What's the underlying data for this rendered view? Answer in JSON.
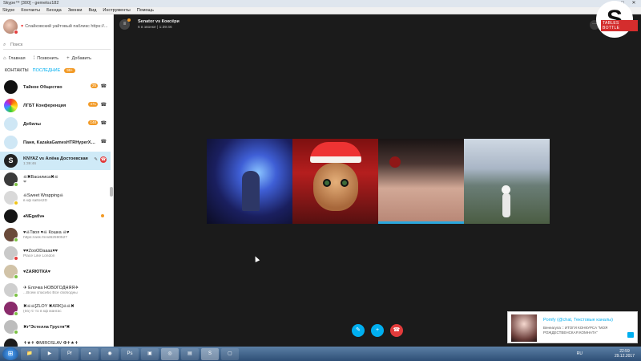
{
  "window": {
    "title": "Skype™ [300] - gemeloz182",
    "buttons": [
      "–",
      "□",
      "✕"
    ]
  },
  "menu": [
    "Skype",
    "Контакты",
    "Беседа",
    "Звонки",
    "Вид",
    "Инструменты",
    "Помощь"
  ],
  "profile": {
    "mood": "Спайковский уайтовый пабликс https://...",
    "status_color": "#e43d3d"
  },
  "search": {
    "placeholder": "Поиск"
  },
  "actions": [
    {
      "icon": "home-icon",
      "label": "Главная"
    },
    {
      "icon": "dialpad-icon",
      "label": "Позвонить"
    },
    {
      "icon": "plus-icon",
      "label": "Добавить"
    }
  ],
  "tabs": {
    "contacts": "КОНТАКТЫ",
    "recent": "ПОСЛЕДНИЕ",
    "recent_badge": "99+"
  },
  "contacts": [
    {
      "name": "Тайное Общество",
      "sub": "",
      "badge": "25",
      "avatar": "#111111",
      "status": "",
      "call": true
    },
    {
      "name": "ЛГБТ Конференция",
      "sub": "",
      "badge": "471",
      "avatar": "rainbow",
      "status": "",
      "call": true
    },
    {
      "name": "Дебилы",
      "sub": "",
      "badge": "148",
      "avatar": "#cfe7f5",
      "status": "",
      "call": true
    },
    {
      "name": "Паня, KazakaGamesHTRHyperX, Д...",
      "sub": "",
      "badge": "",
      "avatar": "#cfe7f5",
      "status": "",
      "call": true
    },
    {
      "name": "KNYAZ vs Алёна Достоевская",
      "sub": "1:39:46",
      "badge": "",
      "avatar": "skype",
      "status": "",
      "call": false,
      "selected": true,
      "end": true
    },
    {
      "name": "☠✖Василиса✖☠",
      "sub": "❤",
      "badge": "",
      "avatar": "#3b3b3b",
      "status": "#7bc142",
      "call": false
    },
    {
      "name": "☠Sweet Wrapping☠",
      "sub": "в кф saltos2D",
      "badge": "",
      "avatar": "#d9d9d9",
      "status": "#f0c419",
      "call": false
    },
    {
      "name": "♠NEgatIv♠",
      "sub": "",
      "badge": "",
      "avatar": "#151515",
      "status": "",
      "call": false,
      "dot": true
    },
    {
      "name": "♥☠Твоя ♥☠ Кошка ☠♥",
      "sub": "https://ask.fm/id62590527",
      "badge": "",
      "avatar": "#6a4a3a",
      "status": "#7bc142",
      "call": false
    },
    {
      "name": "♥♥ZooODaaaa♥♥",
      "sub": "Place Like London",
      "badge": "",
      "avatar": "#c9c9c9",
      "status": "#e43d3d",
      "call": false
    },
    {
      "name": "♥ZAЯЮТКА♥",
      "sub": "",
      "badge": "",
      "avatar": "#d1c3a8",
      "status": "#7bc142",
      "call": false
    },
    {
      "name": "✈ Ёлочка НОВОГОДНЯЯ✈",
      "sub": "...Всем спасибо Все свободны",
      "badge": "",
      "avatar": "#cfcfcf",
      "status": "#7bc142",
      "call": false
    },
    {
      "name": "✖☠☠[ZLOY ✖ARK]☠☠✖",
      "sub": "(бб) © то в кф мангас",
      "badge": "",
      "avatar": "#8a2b6b",
      "status": "#7bc142",
      "call": false
    },
    {
      "name": "✖г°Эстелла Грустя°✖",
      "sub": "",
      "badge": "",
      "avatar": "#bdbdbd",
      "status": "#7bc142",
      "call": false
    },
    {
      "name": "✝★✝ ✠MIROSLAV ✠✝★✝",
      "sub": "В КОНФЕ МЕНЯ ЗАБРОСЬЛЯЮ ДАМ В БЕБ...",
      "badge": "",
      "avatar": "#1c1c1c",
      "status": "#7bc142",
      "call": false
    },
    {
      "name": "✝GODNAXA✝",
      "sub": "В кф хибут,уеба",
      "badge": "",
      "avatar": "#e0e0e0",
      "status": "#f0c419",
      "call": false
    }
  ],
  "call": {
    "title": "Senator vs Коксёри",
    "subtitle": "6 в звонке | 1:39:46",
    "group_icon": "≡",
    "more": "···"
  },
  "controls": [
    {
      "icon": "mic-muted-icon",
      "glyph": "✎",
      "color": "#00aff0"
    },
    {
      "icon": "plus-icon",
      "glyph": "+",
      "color": "#00aff0"
    },
    {
      "icon": "end-call-icon",
      "glyph": "☎",
      "color": "#e23b3b"
    }
  ],
  "logo": {
    "letter": "S",
    "tag": "TABLES BOTTLE"
  },
  "notification": {
    "title": "Pomfy (@chat, Текстовые каналы)",
    "body": "Венеагула  :: ИТОГИ КОНКУРСА \"МОЯ РОЖДЕСТВЕНСКАЯ КОМНАТА\""
  },
  "taskbar": {
    "apps": [
      "📁",
      "▶",
      "Pr",
      "●",
      "◉",
      "Ps",
      "▣",
      "◎",
      "▤",
      "S",
      "▢"
    ],
    "lang": "RU",
    "time": "22:59",
    "date": "29.12.2017"
  }
}
